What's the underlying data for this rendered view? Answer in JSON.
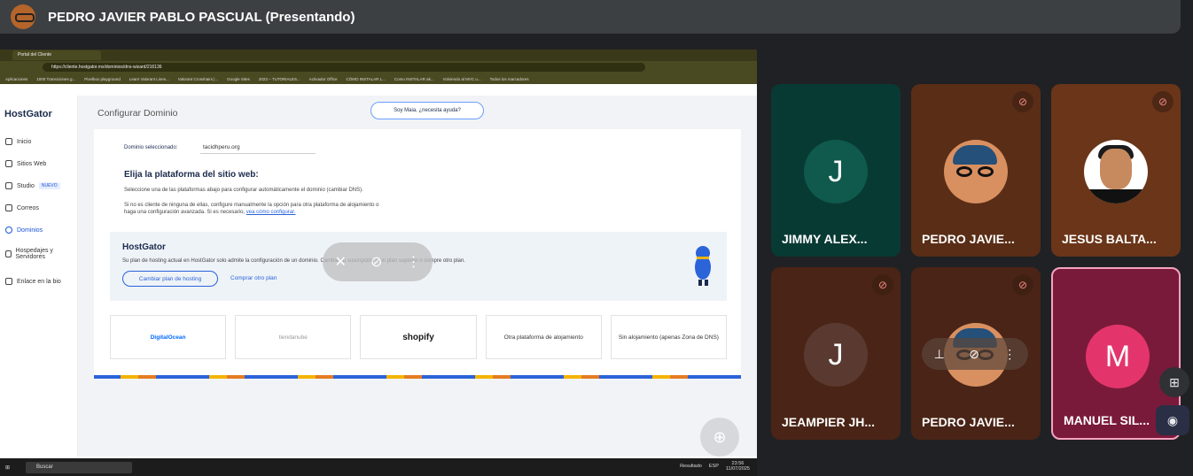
{
  "meet": {
    "presenter_title": "PEDRO JAVIER PABLO PASCUAL (Presentando)"
  },
  "browser": {
    "tab_title": "Portal del Cliente",
    "url": "https://cliente.hostgator.mx/dominios/dns-wizard/216136",
    "bookmarks": [
      "Aplicaciones",
      "1000 Transiciones g...",
      "Pixelbox playground",
      "Learn Valorant Lines...",
      "Valorant Crosshairs |...",
      "Google Sites",
      "2023 – TUTORIALES...",
      "Activador Office",
      "CÓMO INSTALAR L...",
      "Como INSTALAR ak...",
      "Volviendo al MVC u...",
      "Todos los marcadores"
    ]
  },
  "hostgator": {
    "logo": "HostGator",
    "page_title": "Configurar Dominio",
    "maia_button": "Soy Maia, ¿necesita ayuda?",
    "nav": {
      "inicio": "Inicio",
      "sitios": "Sitios Web",
      "studio": "Studio",
      "studio_badge": "NUEVO",
      "correos": "Correos",
      "dominios": "Dominios",
      "hospedajes": "Hospedajes y Servidores",
      "enlace": "Enlace en la bio"
    },
    "domain_label": "Dominio seleccionado:",
    "domain_value": "tacidhperu.org",
    "choose_title": "Elija la plataforma del sitio web:",
    "choose_desc": "Seleccione una de las plataformas abajo para configurar automáticamente el dominio (cambiar DNS).",
    "choose_desc2": "Si no es cliente de ninguna de ellas, configure manualmente la opción para otra plataforma de alojamiento o haga una configuración avanzada. Si es necesario,",
    "choose_link": "vea cómo configurar.",
    "hg_box_title": "HostGator",
    "hg_box_text": "Su plan de hosting actual en HostGator solo admite la configuración de un dominio. Cambie su suscripción a un plan superior o compre otro plan.",
    "btn_change_plan": "Cambiar plan de hosting",
    "btn_buy_plan": "Comprar otro plan",
    "providers": {
      "digitalocean": "DigitalOcean",
      "tiendanube": "tiendanube",
      "shopify": "shopify",
      "other": "Otra plataforma de alojamiento",
      "nohost": "Sin alojamiento (apenas Zona de DNS)"
    }
  },
  "taskbar": {
    "search": "Buscar",
    "weather": "Resultado",
    "lang": "ESP",
    "time": "23:56",
    "date": "11/07/2025"
  },
  "participants": [
    {
      "name": "JIMMY ALEX...",
      "initial": "J",
      "color": "#0f5a4d",
      "bg": "#083a34"
    },
    {
      "name": "PEDRO JAVIE...",
      "initial": "",
      "color": "",
      "bg": "#5a2d16"
    },
    {
      "name": "JESUS BALTA...",
      "initial": "",
      "color": "",
      "bg": "#6a3518"
    },
    {
      "name": "JEAMPIER JH...",
      "initial": "J",
      "color": "#5a3a30",
      "bg": "#4a2416"
    },
    {
      "name": "PEDRO JAVIE...",
      "initial": "",
      "color": "",
      "bg": "#4a2416"
    },
    {
      "name": "MANUEL SIL...",
      "initial": "M",
      "color": "#e3356b",
      "bg": "#7a1a3a"
    }
  ],
  "icons": {
    "mic_off": "mic-off-icon",
    "pin": "pin-icon",
    "more": "more-vert-icon",
    "zoom": "zoom-in-icon"
  }
}
